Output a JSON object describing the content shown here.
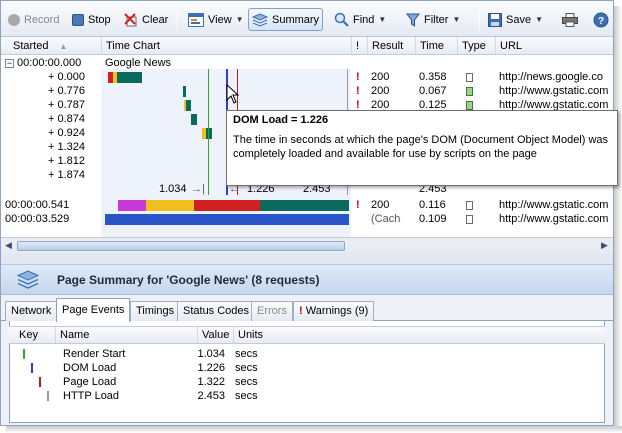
{
  "toolbar": {
    "record": "Record",
    "stop": "Stop",
    "clear": "Clear",
    "view": "View",
    "summary": "Summary",
    "find": "Find",
    "filter": "Filter",
    "save": "Save"
  },
  "grid": {
    "columns": [
      "Started",
      "Time Chart",
      "!",
      "Result",
      "Time",
      "Type",
      "URL"
    ],
    "group": {
      "started": "00:00:00.000",
      "label": "Google News"
    },
    "rows": [
      {
        "started": "+ 0.000",
        "warn": "!",
        "result": "200",
        "time": "0.358",
        "url": "http://news.google.co"
      },
      {
        "started": "+ 0.776",
        "warn": "!",
        "result": "200",
        "time": "0.067",
        "url": "http://www.gstatic.com"
      },
      {
        "started": "+ 0.787",
        "warn": "!",
        "result": "200",
        "time": "0.125",
        "url": "http://www.gstatic.com"
      },
      {
        "started": "+ 0.874",
        "warn": "",
        "result": "",
        "time": "",
        "url": ""
      },
      {
        "started": "+ 0.924",
        "warn": "",
        "result": "",
        "time": "",
        "url": ""
      },
      {
        "started": "+ 1.324",
        "warn": "",
        "result": "",
        "time": "",
        "url": ""
      },
      {
        "started": "+ 1.812",
        "warn": "",
        "result": "",
        "time": "",
        "url": ""
      },
      {
        "started": "+ 1.874",
        "warn": "",
        "result": "",
        "time": "",
        "url": ""
      }
    ],
    "timing_markers": {
      "render": "1.034",
      "dom": "1.226",
      "http": "2.453",
      "total_time": "2.453"
    },
    "extra_rows": [
      {
        "started": "00:00:00.541",
        "warn": "!",
        "result": "200",
        "time": "0.116",
        "url": "http://www.gstatic.com"
      },
      {
        "started": "00:00:03.529",
        "warn": "",
        "result": "(Cache)",
        "time": "0.109",
        "url": "http://www.gstatic.com"
      }
    ]
  },
  "tooltip": {
    "title": "DOM Load = 1.226",
    "body": "The time in seconds at which the page's DOM (Document Object Model) was completely loaded and available for use by scripts on the page"
  },
  "summary": {
    "title": "Page Summary for 'Google News' (8 requests)",
    "tabs": [
      "Network",
      "Page Events",
      "Timings",
      "Status Codes",
      "Errors",
      "Warnings (9)"
    ],
    "columns": [
      "Key",
      "Name",
      "Value",
      "Units"
    ],
    "events": [
      {
        "name": "Render Start",
        "value": "1.034",
        "units": "secs",
        "color": "#2ea82e"
      },
      {
        "name": "DOM Load",
        "value": "1.226",
        "units": "secs",
        "color": "#3a3ad0"
      },
      {
        "name": "Page Load",
        "value": "1.322",
        "units": "secs",
        "color": "#b02020"
      },
      {
        "name": "HTTP Load",
        "value": "2.453",
        "units": "secs",
        "color": "#9a9a9a"
      }
    ]
  },
  "colors": {
    "accent": "#3d6fb4",
    "warning": "#cc0000"
  }
}
